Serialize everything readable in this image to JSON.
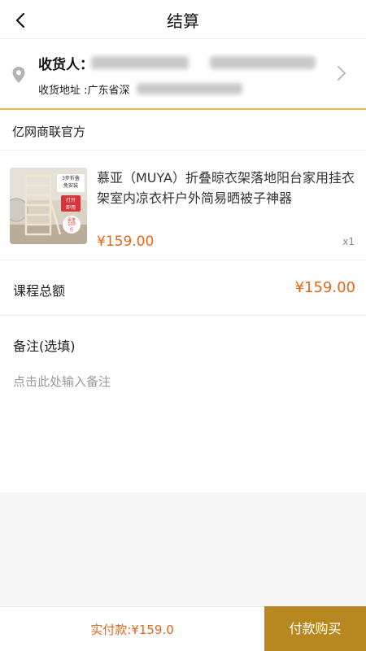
{
  "header": {
    "title": "结算",
    "back_icon": "chevron-left-icon"
  },
  "address": {
    "receiver_label": "收货人：",
    "address_label": "收货地址 :广东省深",
    "location_icon": "location-pin-icon",
    "chevron_icon": "chevron-right-icon",
    "accent_color": "#f0b848"
  },
  "shop": {
    "name": "亿网商联官方"
  },
  "product": {
    "title": "慕亚（MUYA）折叠晾衣架落地阳台家用挂衣架室内凉衣杆户外简易晒被子神器",
    "price": "¥159.00",
    "quantity": "x1",
    "thumb_badge_1": "3步折叠",
    "thumb_badge_2": "免安装",
    "thumb_badge_3": "打开",
    "thumb_badge_4": "即用",
    "thumb_badge_5": "承重",
    "thumb_badge_6": "100",
    "thumb_badge_7": "斤"
  },
  "total": {
    "label": "课程总额",
    "value": "¥159.00"
  },
  "remark": {
    "title": "备注(选填)",
    "placeholder": "点击此处输入备注"
  },
  "footer": {
    "pay_amount": "实付款:¥159.0",
    "pay_button": "付款购买",
    "button_color": "#b7881f",
    "price_color": "#e8661b"
  }
}
